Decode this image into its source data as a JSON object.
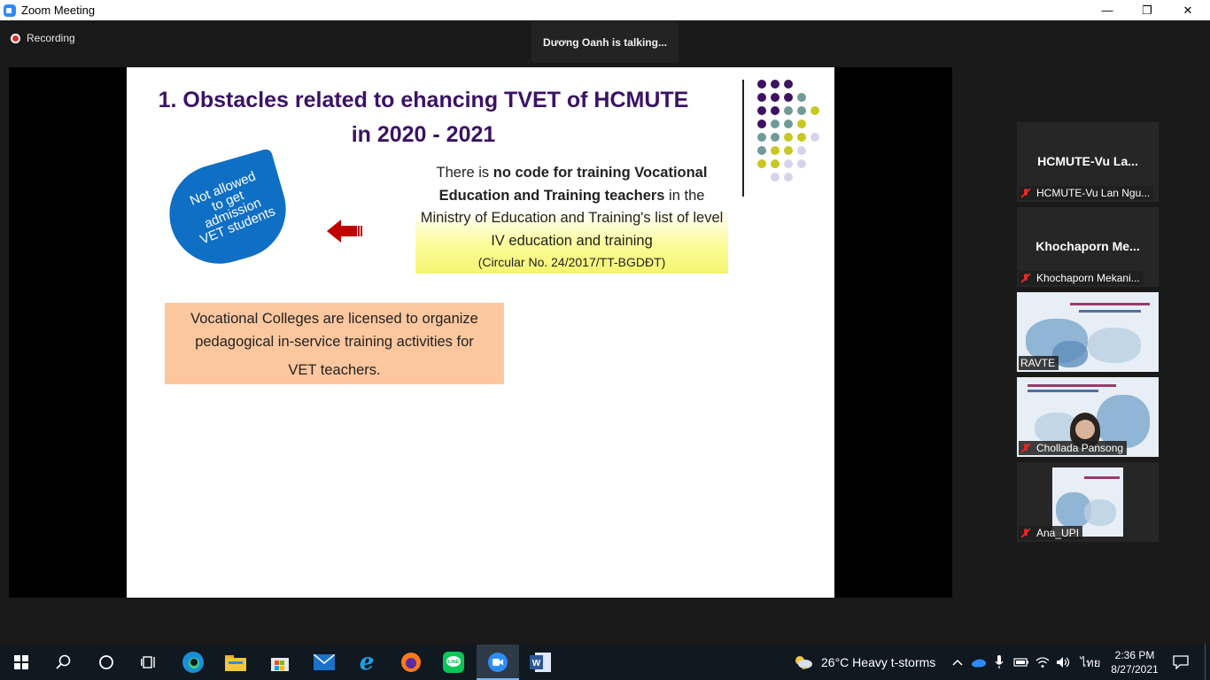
{
  "window": {
    "title": "Zoom Meeting",
    "minimize": "—",
    "restore": "❐",
    "close": "✕"
  },
  "meeting": {
    "recording_label": "Recording",
    "talking_label": "Dương Oanh is talking..."
  },
  "slide": {
    "title_line1": "1. Obstacles related to ehancing TVET of HCMUTE",
    "title_line2": "in 2020 - 2021",
    "leaf_lines": [
      "Not allowed",
      "to get",
      "admission",
      "VET students"
    ],
    "box1": {
      "part1": "There is ",
      "bold1": "no code for training Vocational Education and Training teachers",
      "part2": " in the Ministry of Education and Training's list of level IV education and training",
      "circular": "(Circular No. 24/2017/TT-BGDĐT)"
    },
    "box2": {
      "line1": "Vocational Colleges are licensed to organize",
      "line2": "pedagogical in-service training activities for",
      "line3": "VET teachers."
    },
    "colors": {
      "title": "#3b1363",
      "leaf": "#0f6fc4",
      "arrow": "#c00000",
      "box2": "#fcc79e",
      "dot_purple": "#3b1363",
      "dot_teal": "#6f9a98",
      "dot_yellow": "#c7c722",
      "dot_lavender": "#d6d4ea"
    }
  },
  "participants": [
    {
      "display_name": "HCMUTE-Vu  La...",
      "label": "HCMUTE-Vu Lan Ngu...",
      "muted": true
    },
    {
      "display_name": "Khochaporn  Me...",
      "label": "Khochaporn Mekani...",
      "muted": true
    },
    {
      "label": "RAVTE",
      "muted": false
    },
    {
      "label": "Chollada Pansong",
      "muted": true
    },
    {
      "label": "Ana_UPI",
      "muted": true
    }
  ],
  "taskbar": {
    "weather": "26°C  Heavy t-storms",
    "language": "ไทย",
    "time": "2:36 PM",
    "date": "8/27/2021",
    "icons": [
      "windows-start-icon",
      "search-icon",
      "cortana-icon",
      "task-view-icon",
      "edge-icon",
      "file-explorer-icon",
      "store-icon",
      "mail-icon",
      "ie-icon",
      "firefox-icon",
      "line-icon",
      "zoom-icon",
      "word-icon"
    ]
  }
}
